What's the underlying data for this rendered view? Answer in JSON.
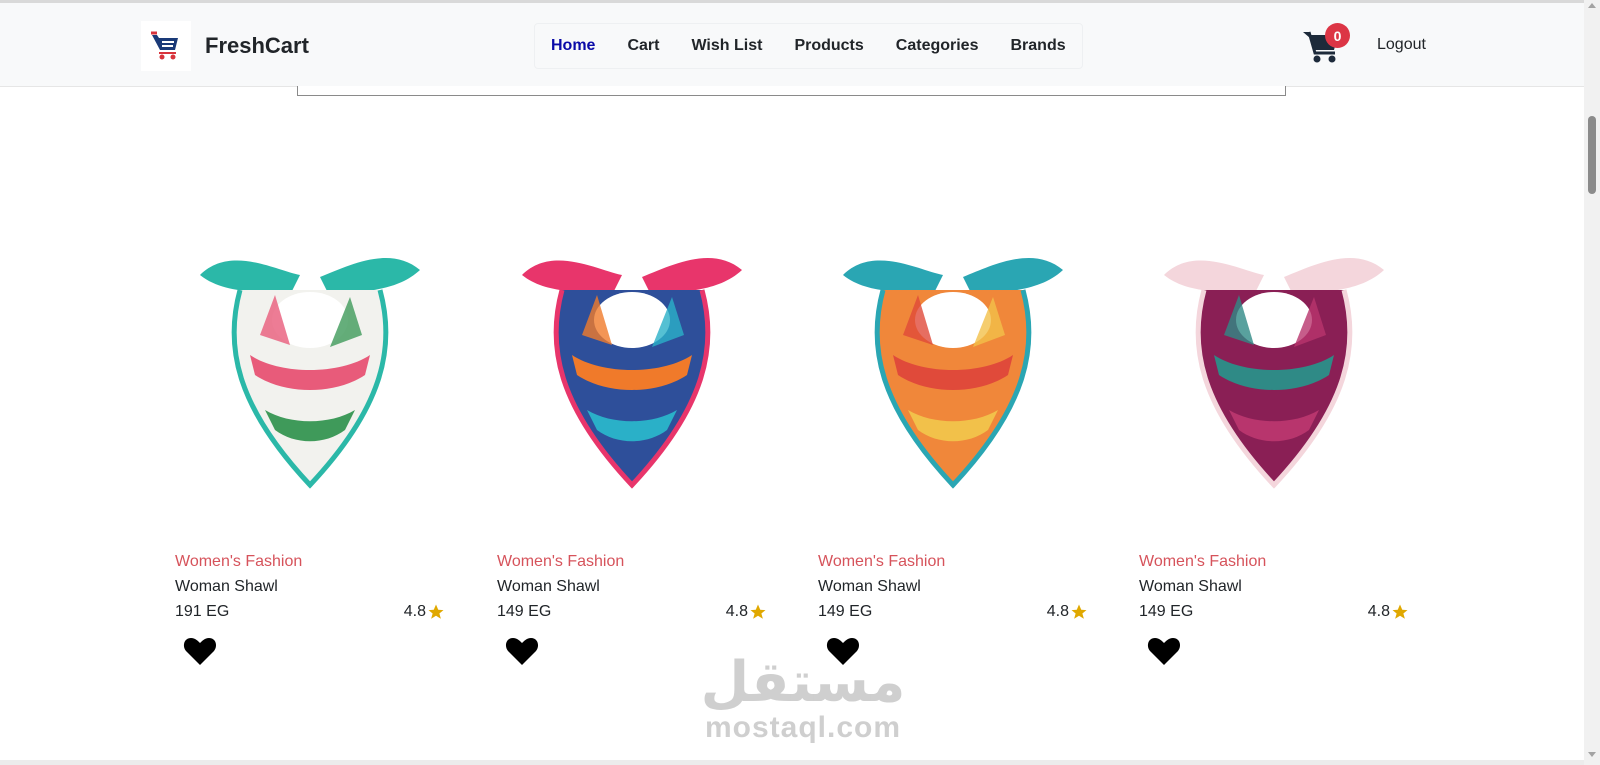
{
  "navbar": {
    "brand_name": "FreshCart",
    "links": [
      {
        "label": "Home",
        "active": true
      },
      {
        "label": "Cart",
        "active": false
      },
      {
        "label": "Wish List",
        "active": false
      },
      {
        "label": "Products",
        "active": false
      },
      {
        "label": "Categories",
        "active": false
      },
      {
        "label": "Brands",
        "active": false
      }
    ],
    "cart_count": "0",
    "logout_label": "Logout"
  },
  "products": [
    {
      "category": "Women's Fashion",
      "title": "Woman Shawl",
      "price": "191 EG",
      "rating": "4.8",
      "colors": [
        "#f2f2ee",
        "#2bb8a8",
        "#e85b7a",
        "#3f9a5a"
      ]
    },
    {
      "category": "Women's Fashion",
      "title": "Woman Shawl",
      "price": "149 EG",
      "rating": "4.8",
      "colors": [
        "#2e4f9a",
        "#e8356b",
        "#f07a2a",
        "#2ab0c8"
      ]
    },
    {
      "category": "Women's Fashion",
      "title": "Woman Shawl",
      "price": "149 EG",
      "rating": "4.8",
      "colors": [
        "#f0873a",
        "#2aa6b3",
        "#e04a3a",
        "#f2c14a"
      ]
    },
    {
      "category": "Women's Fashion",
      "title": "Woman Shawl",
      "price": "149 EG",
      "rating": "4.8",
      "colors": [
        "#8a1f55",
        "#f4d6dc",
        "#2f8a86",
        "#b8356d"
      ]
    }
  ],
  "watermark": {
    "arabic": "مستقل",
    "latin": "mostaql.com"
  },
  "theme": {
    "accent": "#0a0aa8",
    "category_color": "#d6535b",
    "badge_color": "#dc3545",
    "star_color": "#e0a800"
  }
}
